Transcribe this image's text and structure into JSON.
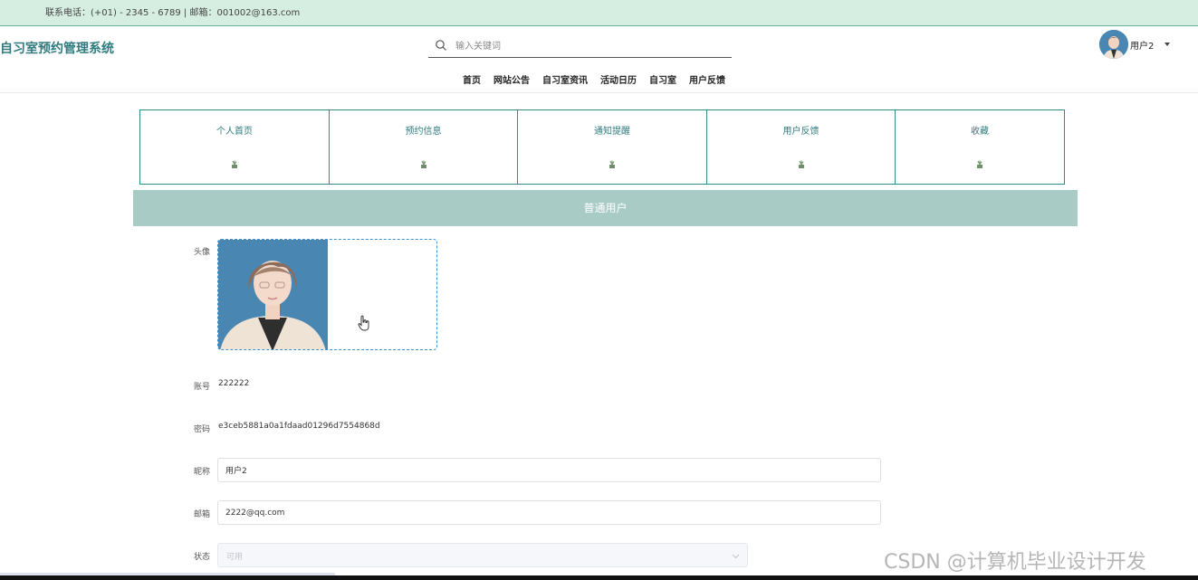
{
  "topbar": {
    "contact_text": "联系电话：(+01) - 2345 - 6789 | 邮箱：001002@163.com"
  },
  "header": {
    "site_title": "自习室预约管理系统",
    "search_placeholder": "输入关键词",
    "search_icon": "search-icon",
    "user_name": "用户2",
    "user_caret_icon": "caret-down-icon"
  },
  "nav": {
    "items": [
      "首页",
      "网站公告",
      "自习室资讯",
      "活动日历",
      "自习室",
      "用户反馈"
    ]
  },
  "tabs": {
    "items": [
      {
        "label": "个人首页",
        "icon": "plant-icon"
      },
      {
        "label": "预约信息",
        "icon": "plant-icon"
      },
      {
        "label": "通知提醒",
        "icon": "plant-icon"
      },
      {
        "label": "用户反馈",
        "icon": "plant-icon"
      },
      {
        "label": "收藏",
        "icon": "plant-icon"
      }
    ]
  },
  "profile": {
    "role_title": "普通用户",
    "avatar_label": "头像",
    "account_label": "账号",
    "account_value": "222222",
    "password_label": "密码",
    "password_value": "e3ceb5881a0a1fdaad01296d7554868d",
    "nickname_label": "昵称",
    "nickname_value": "用户2",
    "email_label": "邮箱",
    "email_value": "2222@qq.com",
    "status_label": "状态",
    "status_value": "可用"
  },
  "watermark": "CSDN @计算机毕业设计开发",
  "colors": {
    "topbar_bg": "#d6eee2",
    "accent": "#2f7b7e",
    "tab_border": "#2f8a8a",
    "banner_bg": "#a9cbc6",
    "upload_border": "#3d8fd0"
  }
}
